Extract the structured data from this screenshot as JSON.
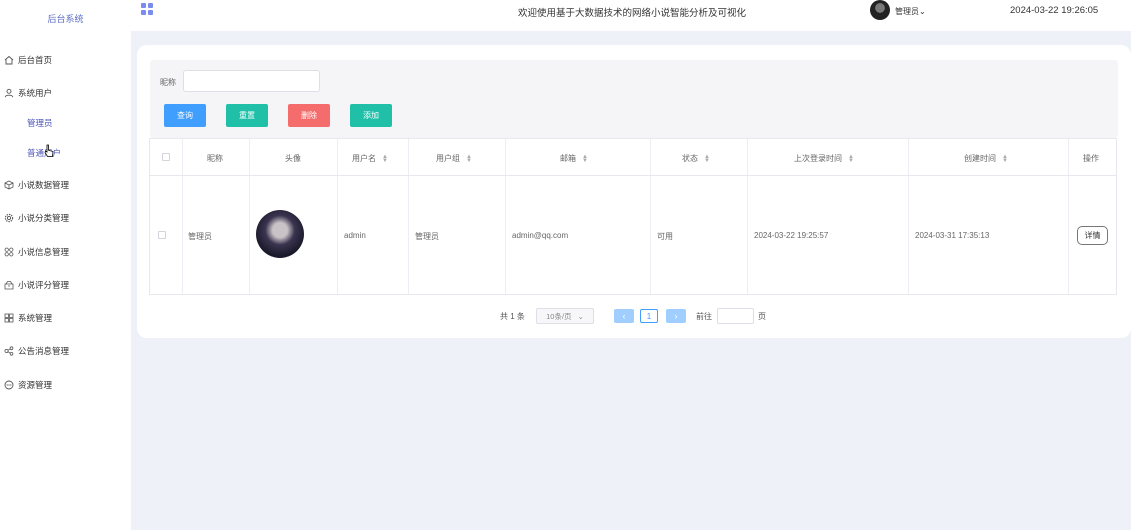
{
  "sidebar": {
    "brand": "后台系统",
    "items": [
      {
        "label": "后台首页",
        "icon": "home-icon"
      },
      {
        "label": "系统用户",
        "icon": "user-icon"
      },
      {
        "label": "小说数据管理",
        "icon": "cube-icon"
      },
      {
        "label": "小说分类管理",
        "icon": "gear-icon"
      },
      {
        "label": "小说信息管理",
        "icon": "apps-icon"
      },
      {
        "label": "小说评分管理",
        "icon": "box-icon"
      },
      {
        "label": "系统管理",
        "icon": "grid-icon"
      },
      {
        "label": "公告消息管理",
        "icon": "share-icon"
      },
      {
        "label": "资源管理",
        "icon": "chat-icon"
      }
    ],
    "sub_items": [
      {
        "label": "管理员"
      },
      {
        "label": "普通用户"
      }
    ]
  },
  "header": {
    "title": "欢迎使用基于大数据技术的网络小说智能分析及可视化",
    "user": "管理员",
    "datetime": "2024-03-22 19:26:05"
  },
  "search": {
    "label": "昵称",
    "value": "",
    "buttons": {
      "query": "查询",
      "reset": "重置",
      "delete": "删除",
      "add": "添加"
    }
  },
  "table": {
    "columns": [
      "昵称",
      "头像",
      "用户名",
      "用户组",
      "邮箱",
      "状态",
      "上次登录时间",
      "创建时间",
      "操作"
    ],
    "rows": [
      {
        "nickname": "管理员",
        "username": "admin",
        "group": "管理员",
        "email": "admin@qq.com",
        "status": "可用",
        "last_login": "2024-03-22 19:25:57",
        "created": "2024-03-31 17:35:13",
        "action": "详情"
      }
    ]
  },
  "pagination": {
    "total": "共 1 条",
    "page_size": "10条/页",
    "current": "1",
    "goto_label": "前往",
    "page_suffix": "页"
  },
  "colors": {
    "accent": "#409eff",
    "teal": "#1fbfa8",
    "danger": "#f56c6c",
    "sidebar_text": "#4c55b8"
  }
}
